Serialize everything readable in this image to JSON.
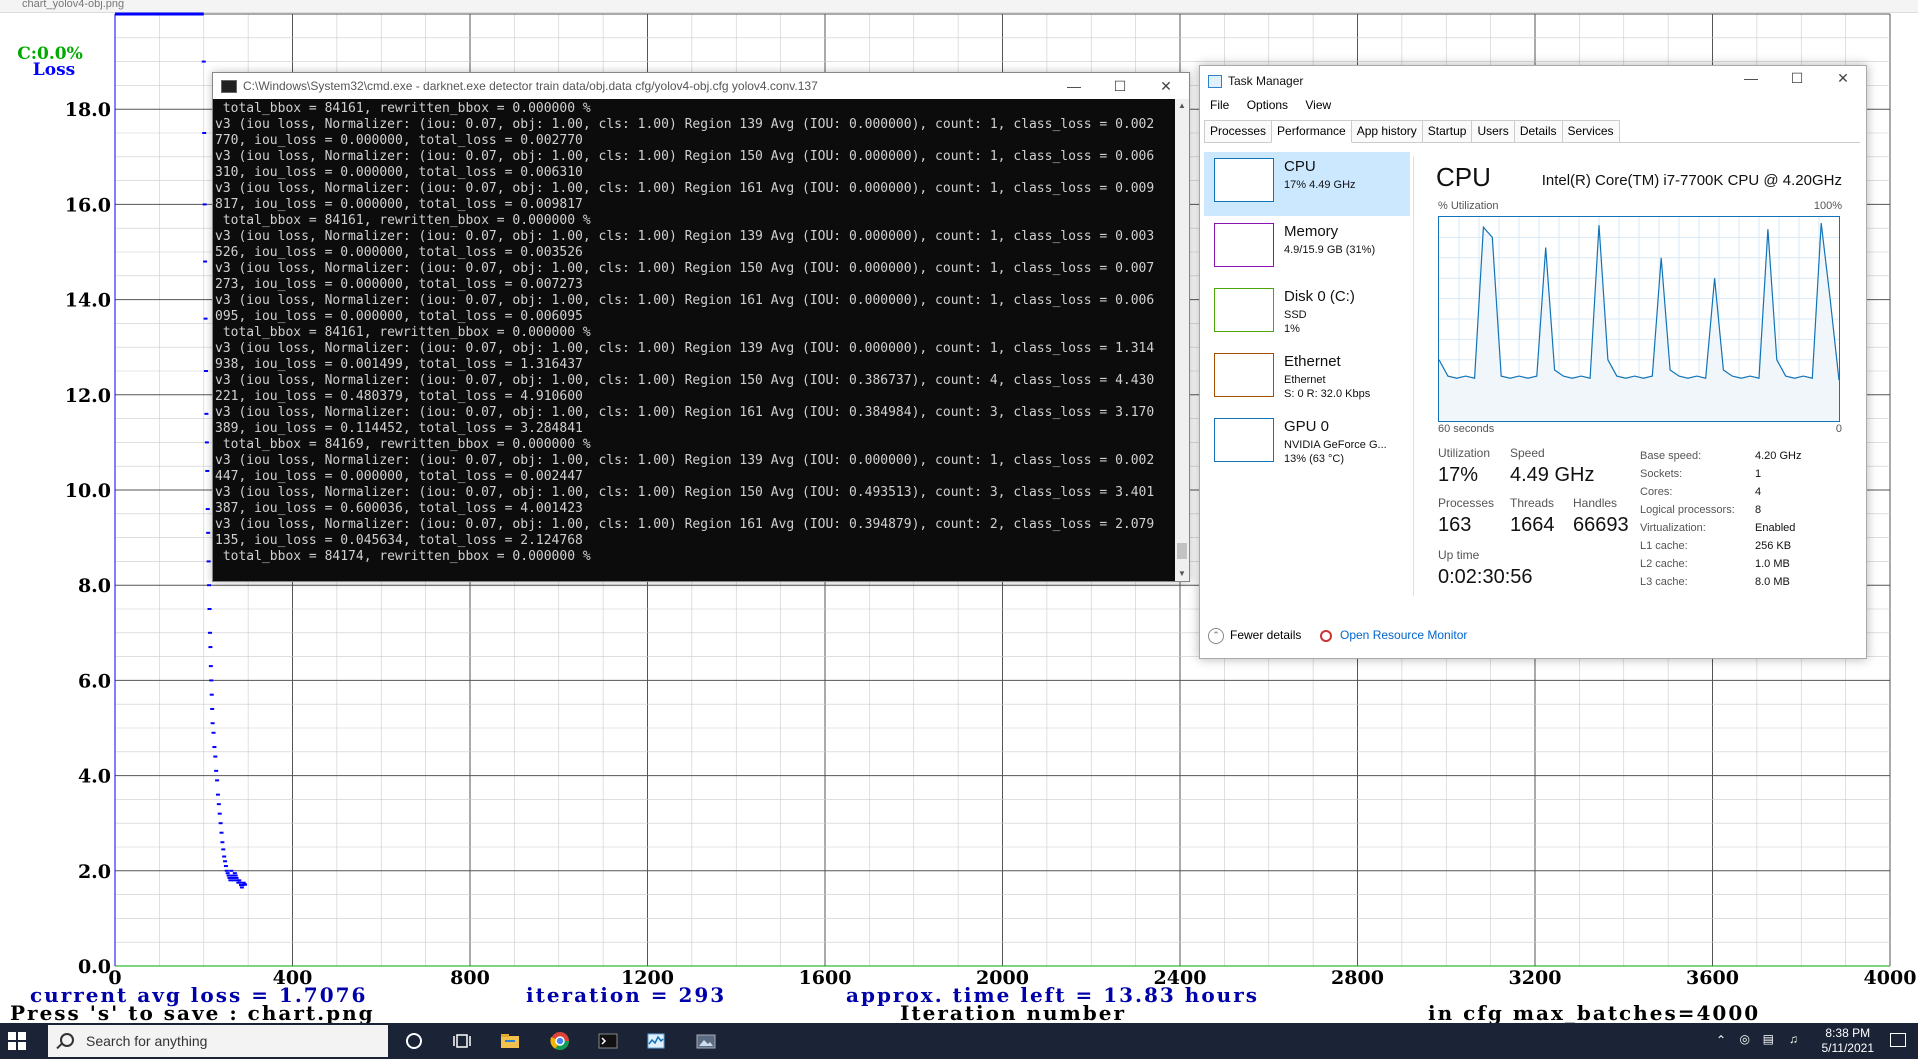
{
  "chart_window": {
    "title": "chart_yolov4-obj.png",
    "chart_data": {
      "type": "scatter",
      "title": "",
      "xlabel": "Iteration number",
      "ylabel": "Loss",
      "xlim": [
        0,
        4000
      ],
      "ylim": [
        0,
        20
      ],
      "x_ticks": [
        "0",
        "400",
        "800",
        "1200",
        "1600",
        "2000",
        "2400",
        "2800",
        "3200",
        "3600",
        "4000"
      ],
      "y_ticks": [
        "0.0",
        "2.0",
        "4.0",
        "6.0",
        "8.0",
        "10.0",
        "12.0",
        "14.0",
        "16.0",
        "18.0"
      ],
      "grid": true,
      "accuracy_label": "C:0.0%",
      "loss_label": "Loss",
      "series": [
        {
          "name": "avg loss",
          "color": "#0000ff",
          "x": [
            200,
            201,
            202,
            203,
            204,
            205,
            206,
            207,
            208,
            209,
            210,
            211,
            212,
            213,
            214,
            215,
            216,
            217,
            218,
            219,
            220,
            222,
            224,
            226,
            228,
            230,
            232,
            234,
            236,
            238,
            240,
            242,
            244,
            246,
            248,
            250,
            252,
            254,
            256,
            258,
            260,
            262,
            264,
            266,
            268,
            270,
            272,
            274,
            276,
            278,
            280,
            282,
            284,
            286,
            288,
            290,
            292,
            293
          ],
          "y": [
            19.0,
            17.5,
            16.0,
            14.8,
            13.6,
            12.5,
            11.6,
            11.0,
            10.4,
            9.6,
            9.1,
            8.5,
            8.0,
            7.5,
            7.0,
            6.7,
            6.3,
            6.0,
            5.7,
            5.4,
            5.1,
            4.9,
            4.6,
            4.4,
            4.1,
            3.9,
            3.6,
            3.4,
            3.2,
            3.0,
            2.8,
            2.6,
            2.45,
            2.3,
            2.2,
            2.1,
            2.0,
            1.95,
            1.9,
            1.85,
            1.8,
            2.0,
            1.9,
            1.85,
            1.8,
            1.95,
            1.9,
            1.85,
            1.8,
            1.75,
            1.8,
            1.75,
            1.7,
            1.65,
            1.7,
            1.75,
            1.72,
            1.7076
          ]
        }
      ]
    },
    "status": {
      "line1_loss": "current avg loss = 1.7076",
      "line1_iter": "iteration = 293",
      "line1_time": "approx. time left = 13.83 hours",
      "line2_save": "Press 's' to save : chart.png",
      "line2_xlabel": "Iteration number",
      "line2_batches": "in cfg max_batches=4000"
    }
  },
  "cmd_window": {
    "title": "C:\\Windows\\System32\\cmd.exe - darknet.exe  detector train data/obj.data cfg/yolov4-obj.cfg yolov4.conv.137",
    "lines": [
      " total_bbox = 84161, rewritten_bbox = 0.000000 %",
      "v3 (iou loss, Normalizer: (iou: 0.07, obj: 1.00, cls: 1.00) Region 139 Avg (IOU: 0.000000), count: 1, class_loss = 0.002",
      "770, iou_loss = 0.000000, total_loss = 0.002770",
      "v3 (iou loss, Normalizer: (iou: 0.07, obj: 1.00, cls: 1.00) Region 150 Avg (IOU: 0.000000), count: 1, class_loss = 0.006",
      "310, iou_loss = 0.000000, total_loss = 0.006310",
      "v3 (iou loss, Normalizer: (iou: 0.07, obj: 1.00, cls: 1.00) Region 161 Avg (IOU: 0.000000), count: 1, class_loss = 0.009",
      "817, iou_loss = 0.000000, total_loss = 0.009817",
      " total_bbox = 84161, rewritten_bbox = 0.000000 %",
      "v3 (iou loss, Normalizer: (iou: 0.07, obj: 1.00, cls: 1.00) Region 139 Avg (IOU: 0.000000), count: 1, class_loss = 0.003",
      "526, iou_loss = 0.000000, total_loss = 0.003526",
      "v3 (iou loss, Normalizer: (iou: 0.07, obj: 1.00, cls: 1.00) Region 150 Avg (IOU: 0.000000), count: 1, class_loss = 0.007",
      "273, iou_loss = 0.000000, total_loss = 0.007273",
      "v3 (iou loss, Normalizer: (iou: 0.07, obj: 1.00, cls: 1.00) Region 161 Avg (IOU: 0.000000), count: 1, class_loss = 0.006",
      "095, iou_loss = 0.000000, total_loss = 0.006095",
      " total_bbox = 84161, rewritten_bbox = 0.000000 %",
      "v3 (iou loss, Normalizer: (iou: 0.07, obj: 1.00, cls: 1.00) Region 139 Avg (IOU: 0.000000), count: 1, class_loss = 1.314",
      "938, iou_loss = 0.001499, total_loss = 1.316437",
      "v3 (iou loss, Normalizer: (iou: 0.07, obj: 1.00, cls: 1.00) Region 150 Avg (IOU: 0.386737), count: 4, class_loss = 4.430",
      "221, iou_loss = 0.480379, total_loss = 4.910600",
      "v3 (iou loss, Normalizer: (iou: 0.07, obj: 1.00, cls: 1.00) Region 161 Avg (IOU: 0.384984), count: 3, class_loss = 3.170",
      "389, iou_loss = 0.114452, total_loss = 3.284841",
      " total_bbox = 84169, rewritten_bbox = 0.000000 %",
      "v3 (iou loss, Normalizer: (iou: 0.07, obj: 1.00, cls: 1.00) Region 139 Avg (IOU: 0.000000), count: 1, class_loss = 0.002",
      "447, iou_loss = 0.000000, total_loss = 0.002447",
      "v3 (iou loss, Normalizer: (iou: 0.07, obj: 1.00, cls: 1.00) Region 150 Avg (IOU: 0.493513), count: 3, class_loss = 3.401",
      "387, iou_loss = 0.600036, total_loss = 4.001423",
      "v3 (iou loss, Normalizer: (iou: 0.07, obj: 1.00, cls: 1.00) Region 161 Avg (IOU: 0.394879), count: 2, class_loss = 2.079",
      "135, iou_loss = 0.045634, total_loss = 2.124768",
      " total_bbox = 84174, rewritten_bbox = 0.000000 %"
    ]
  },
  "task_manager": {
    "title": "Task Manager",
    "menu": [
      "File",
      "Options",
      "View"
    ],
    "tabs": [
      "Processes",
      "Performance",
      "App history",
      "Startup",
      "Users",
      "Details",
      "Services"
    ],
    "active_tab": "Performance",
    "side_items": [
      {
        "name": "CPU",
        "sub1": "17% 4.49 GHz",
        "sub2": "",
        "color": "#1174b8"
      },
      {
        "name": "Memory",
        "sub1": "4.9/15.9 GB (31%)",
        "sub2": "",
        "color": "#8b12ae"
      },
      {
        "name": "Disk 0 (C:)",
        "sub1": "SSD",
        "sub2": "1%",
        "color": "#4da60c"
      },
      {
        "name": "Ethernet",
        "sub1": "Ethernet",
        "sub2": "S: 0 R: 32.0 Kbps",
        "color": "#a74f01"
      },
      {
        "name": "GPU 0",
        "sub1": "NVIDIA GeForce G...",
        "sub2": "13% (63 °C)",
        "color": "#1174b8"
      }
    ],
    "cpu": {
      "title": "CPU",
      "model": "Intel(R) Core(TM) i7-7700K CPU @ 4.20GHz",
      "util_label": "% Utilization",
      "util_max": "100%",
      "graph_left": "60 seconds",
      "graph_right": "0",
      "graph_values": [
        30,
        22,
        21,
        22,
        21,
        95,
        90,
        22,
        21,
        22,
        21,
        22,
        85,
        25,
        22,
        21,
        22,
        21,
        96,
        30,
        22,
        21,
        22,
        21,
        22,
        80,
        25,
        22,
        21,
        22,
        21,
        70,
        25,
        22,
        21,
        22,
        21,
        94,
        30,
        22,
        21,
        22,
        21,
        97,
        60,
        20
      ],
      "utilization_label": "Utilization",
      "utilization": "17%",
      "speed_label": "Speed",
      "speed": "4.49 GHz",
      "processes_label": "Processes",
      "processes": "163",
      "threads_label": "Threads",
      "threads": "1664",
      "handles_label": "Handles",
      "handles": "66693",
      "uptime_label": "Up time",
      "uptime": "0:02:30:56",
      "info": [
        {
          "k": "Base speed:",
          "v": "4.20 GHz"
        },
        {
          "k": "Sockets:",
          "v": "1"
        },
        {
          "k": "Cores:",
          "v": "4"
        },
        {
          "k": "Logical processors:",
          "v": "8"
        },
        {
          "k": "Virtualization:",
          "v": "Enabled"
        },
        {
          "k": "L1 cache:",
          "v": "256 KB"
        },
        {
          "k": "L2 cache:",
          "v": "1.0 MB"
        },
        {
          "k": "L3 cache:",
          "v": "8.0 MB"
        }
      ]
    },
    "footer": {
      "fewer": "Fewer details",
      "resource_monitor": "Open Resource Monitor"
    }
  },
  "taskbar": {
    "search_placeholder": "Search for anything",
    "time": "8:38 PM",
    "date": "5/11/2021"
  }
}
